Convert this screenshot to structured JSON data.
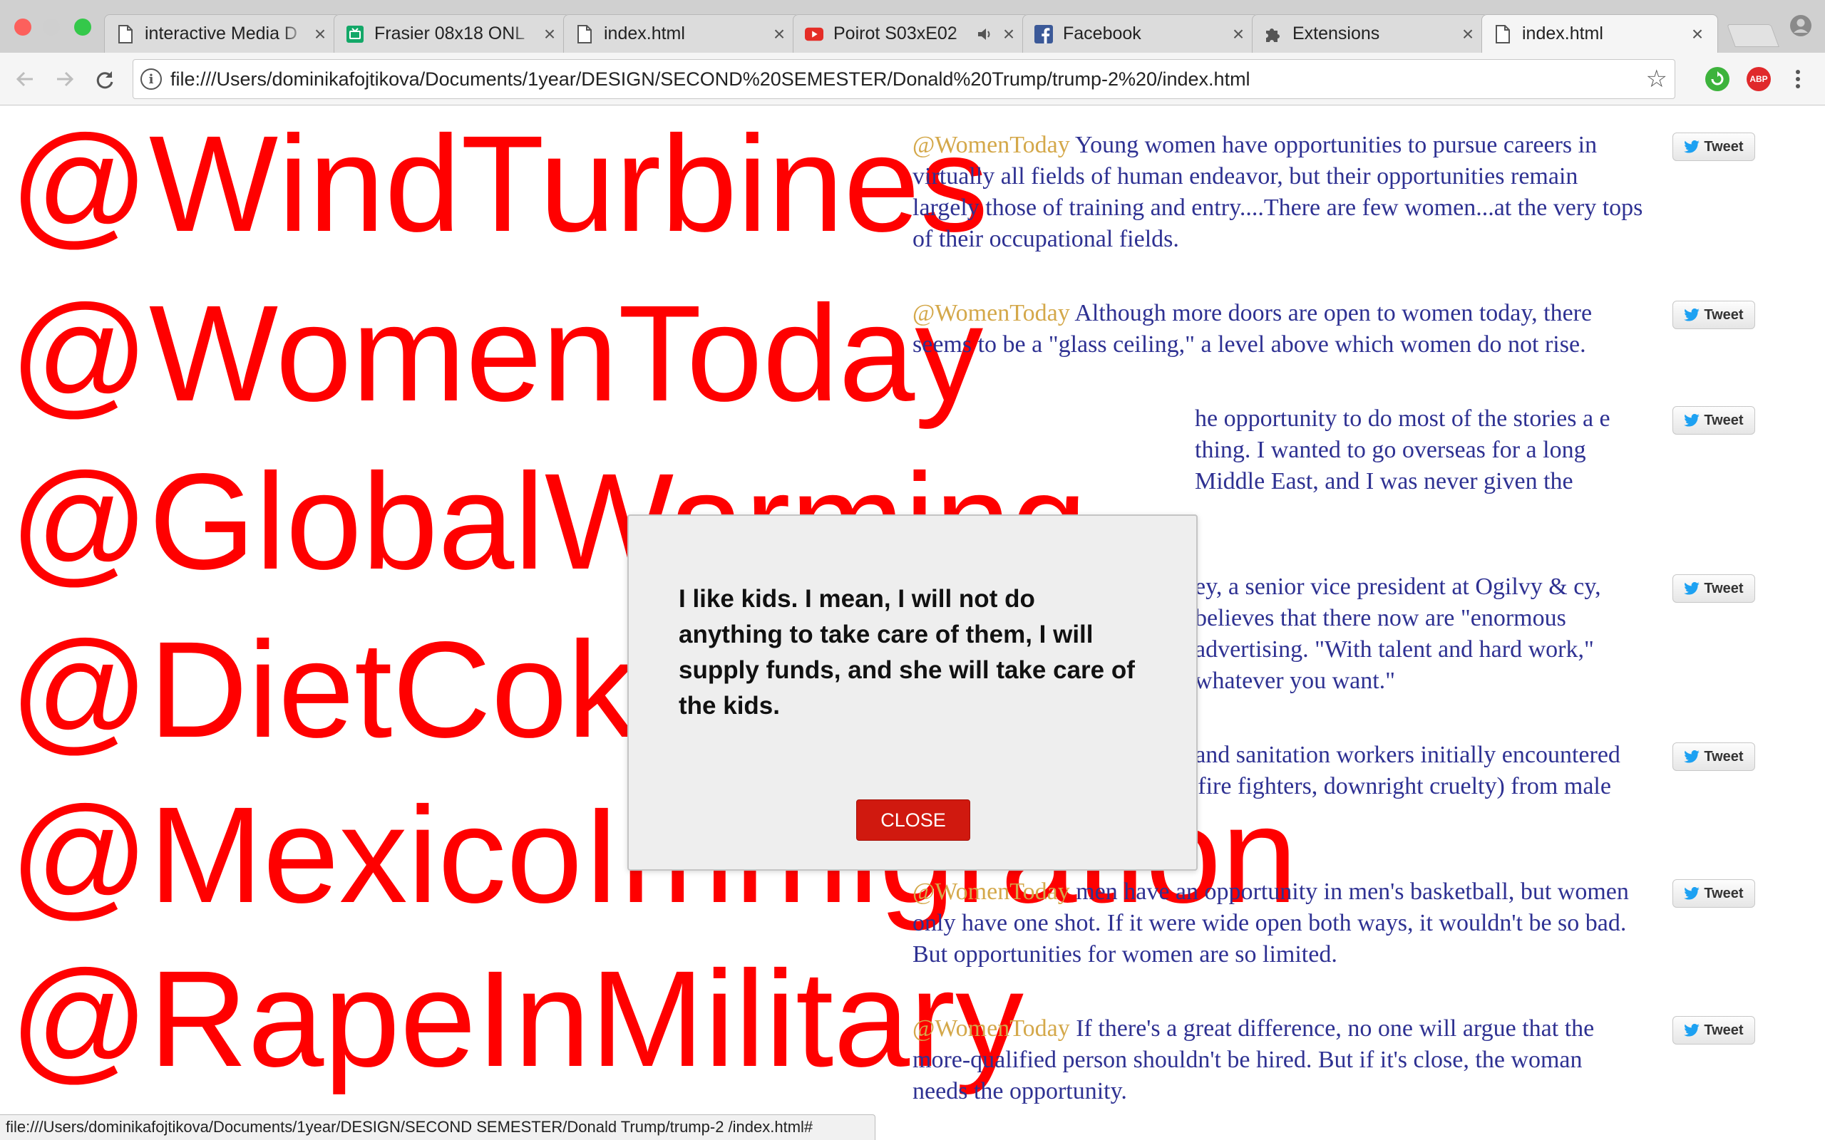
{
  "browser": {
    "tabs": [
      {
        "title": "interactive Media D",
        "icon": "page-icon",
        "active": false
      },
      {
        "title": "Frasier 08x18 ONL",
        "icon": "tv-icon",
        "active": false
      },
      {
        "title": "index.html",
        "icon": "page-icon",
        "active": false
      },
      {
        "title": "Poirot S03xE02",
        "icon": "youtube-icon",
        "active": false,
        "audio": true
      },
      {
        "title": "Facebook",
        "icon": "facebook-icon",
        "active": false
      },
      {
        "title": "Extensions",
        "icon": "puzzle-icon",
        "active": false
      },
      {
        "title": "index.html",
        "icon": "page-icon",
        "active": true
      }
    ],
    "tab_close_glyph": "×",
    "url": "file:///Users/dominikafojtikova/Documents/1year/DESIGN/SECOND%20SEMESTER/Donald%20Trump/trump-2%20/index.html",
    "extensions": {
      "abp_label": "ABP"
    },
    "status_url": "file:///Users/dominikafojtikova/Documents/1year/DESIGN/SECOND SEMESTER/Donald Trump/trump-2 /index.html#"
  },
  "hashtags": [
    "@WindTurbines",
    "@WomenToday",
    "@GlobalWarming",
    "@DietCoke",
    "@MexicoImmigration",
    "@RapeInMilitary"
  ],
  "tweets": [
    {
      "handle": "@WomenToday",
      "text": " Young women have opportunities to pursue careers in virtually all fields of human endeavor, but their opportunities remain largely those of training and entry....There are few women...at the very tops of their occupational fields."
    },
    {
      "handle": "@WomenToday",
      "text": " Although more doors are open to women today, there seems to be a \"glass ceiling,\" a level above which women do not rise."
    },
    {
      "handle": "",
      "text": "he opportunity to do most of the stories a    e thing. I wanted to go overseas for a long    Middle East, and I was never given the"
    },
    {
      "handle": "",
      "text": "ey, a senior vice president at Ogilvy &    cy, believes that there now are \"enormous    advertising. \"With talent and hard work,\"    whatever you want.\""
    },
    {
      "handle": "",
      "text": "ork City, female fire fighters and sanitation workers initially encountered resistance (and in the case of fire fighters, downright cruelty) from male colleagues."
    },
    {
      "handle": "@WomenToday",
      "text": " men have an opportunity in men's basketball, but women only have one shot. If it were wide open both ways, it wouldn't be so bad. But opportunities for women are so limited."
    },
    {
      "handle": "@WomenToday",
      "text": " If there's a great difference, no one will argue that the more-qualified person shouldn't be hired. But if it's close, the woman needs the opportunity."
    }
  ],
  "tweet_button_label": "Tweet",
  "modal": {
    "message": "I like kids. I mean, I will not do anything to take care of them, I will supply funds, and she will take care of the kids.",
    "close_label": "CLOSE"
  },
  "colors": {
    "hashtag": "#ff0000",
    "tweet_text": "#2e3192",
    "tweet_handle": "#d4a84a",
    "close_button": "#d0190f"
  }
}
